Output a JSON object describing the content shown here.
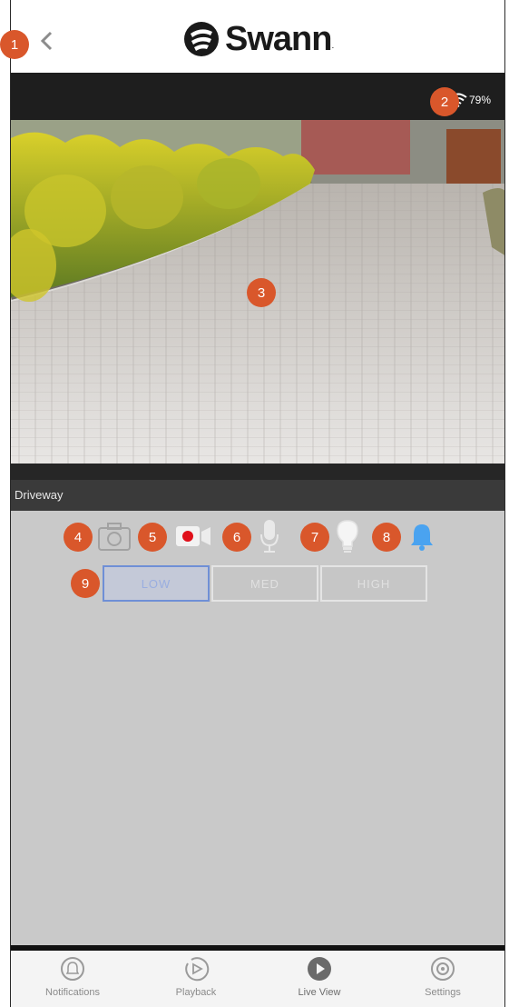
{
  "header": {
    "logo_text": "Swann",
    "logo_mark": "."
  },
  "status": {
    "signal_text": "79%",
    "signal_icon": "wifi-icon"
  },
  "camera": {
    "name": "Driveway"
  },
  "controls": [
    {
      "id": "snapshot",
      "icon": "camera-icon"
    },
    {
      "id": "record",
      "icon": "record-icon"
    },
    {
      "id": "microphone",
      "icon": "microphone-icon"
    },
    {
      "id": "light",
      "icon": "lightbulb-icon"
    },
    {
      "id": "alarm",
      "icon": "bell-icon"
    }
  ],
  "resolution": {
    "options": [
      "LOW",
      "MED",
      "HIGH"
    ],
    "selected": "LOW"
  },
  "annotations": [
    "1",
    "2",
    "3",
    "4",
    "5",
    "6",
    "7",
    "8",
    "9"
  ],
  "nav": {
    "items": [
      {
        "label": "Notifications",
        "icon": "bell-circle-icon"
      },
      {
        "label": "Playback",
        "icon": "playback-icon"
      },
      {
        "label": "Live View",
        "icon": "play-icon"
      },
      {
        "label": "Settings",
        "icon": "gear-icon"
      }
    ],
    "active": "Live View"
  },
  "colors": {
    "badge": "#d9572b",
    "selected_border": "#6f8fd6",
    "record_dot": "#e0101a",
    "bell": "#4aa3f0"
  }
}
